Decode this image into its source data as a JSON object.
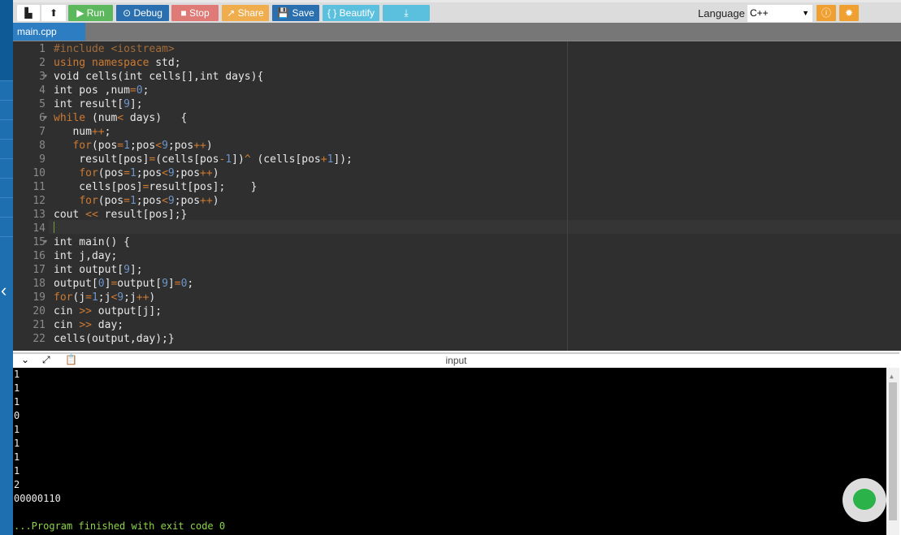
{
  "toolbar": {
    "run": "▶ Run",
    "debug": "⊙ Debug",
    "stop": "■ Stop",
    "share": "↗ Share",
    "save": "💾 Save",
    "beautify": "{ } Beautify",
    "language_label": "Language",
    "language_value": "C++"
  },
  "colors": {
    "run": "#5cb85c",
    "debug": "#2a6fb0",
    "stop": "#d9534f",
    "share": "#f0ad4e",
    "save": "#2a6fb0",
    "beautify": "#5bc0de",
    "accent": "#f0a030"
  },
  "file_tab": "main.cpp",
  "code": [
    [
      [
        "s",
        "#include <iostream>"
      ]
    ],
    [
      [
        "k",
        "using namespace"
      ],
      [
        "p",
        " std;"
      ]
    ],
    [
      [
        "p",
        "void cells(int cells[],int days){"
      ]
    ],
    [
      [
        "p",
        "int pos ,num"
      ],
      [
        "o",
        "="
      ],
      [
        "n",
        "0"
      ],
      [
        "p",
        ";"
      ]
    ],
    [
      [
        "p",
        "int result["
      ],
      [
        "n",
        "9"
      ],
      [
        "p",
        "];"
      ]
    ],
    [
      [
        "k",
        "while"
      ],
      [
        "p",
        " (num"
      ],
      [
        "o",
        "<"
      ],
      [
        "p",
        " days)   {"
      ]
    ],
    [
      [
        "p",
        "   num"
      ],
      [
        "o",
        "++"
      ],
      [
        "p",
        ";"
      ]
    ],
    [
      [
        "p",
        "   "
      ],
      [
        "k",
        "for"
      ],
      [
        "p",
        "(pos"
      ],
      [
        "o",
        "="
      ],
      [
        "n",
        "1"
      ],
      [
        "p",
        ";pos"
      ],
      [
        "o",
        "<"
      ],
      [
        "n",
        "9"
      ],
      [
        "p",
        ";pos"
      ],
      [
        "o",
        "++"
      ],
      [
        "p",
        ")"
      ]
    ],
    [
      [
        "p",
        "    result[pos]"
      ],
      [
        "o",
        "="
      ],
      [
        "p",
        "(cells[pos"
      ],
      [
        "o",
        "-"
      ],
      [
        "n",
        "1"
      ],
      [
        "p",
        "])"
      ],
      [
        "o",
        "^"
      ],
      [
        "p",
        " (cells[pos"
      ],
      [
        "o",
        "+"
      ],
      [
        "n",
        "1"
      ],
      [
        "p",
        "]);"
      ]
    ],
    [
      [
        "p",
        "    "
      ],
      [
        "k",
        "for"
      ],
      [
        "p",
        "(pos"
      ],
      [
        "o",
        "="
      ],
      [
        "n",
        "1"
      ],
      [
        "p",
        ";pos"
      ],
      [
        "o",
        "<"
      ],
      [
        "n",
        "9"
      ],
      [
        "p",
        ";pos"
      ],
      [
        "o",
        "++"
      ],
      [
        "p",
        ")"
      ]
    ],
    [
      [
        "p",
        "    cells[pos]"
      ],
      [
        "o",
        "="
      ],
      [
        "p",
        "result[pos];    }"
      ]
    ],
    [
      [
        "p",
        "    "
      ],
      [
        "k",
        "for"
      ],
      [
        "p",
        "(pos"
      ],
      [
        "o",
        "="
      ],
      [
        "n",
        "1"
      ],
      [
        "p",
        ";pos"
      ],
      [
        "o",
        "<"
      ],
      [
        "n",
        "9"
      ],
      [
        "p",
        ";pos"
      ],
      [
        "o",
        "++"
      ],
      [
        "p",
        ")"
      ]
    ],
    [
      [
        "p",
        "cout "
      ],
      [
        "o",
        "<<"
      ],
      [
        "p",
        " result[pos];}"
      ]
    ],
    [],
    [
      [
        "p",
        "int main() {"
      ]
    ],
    [
      [
        "p",
        "int j,day;"
      ]
    ],
    [
      [
        "p",
        "int output["
      ],
      [
        "n",
        "9"
      ],
      [
        "p",
        "];"
      ]
    ],
    [
      [
        "p",
        "output["
      ],
      [
        "n",
        "0"
      ],
      [
        "p",
        "]"
      ],
      [
        "o",
        "="
      ],
      [
        "p",
        "output["
      ],
      [
        "n",
        "9"
      ],
      [
        "p",
        "]"
      ],
      [
        "o",
        "="
      ],
      [
        "n",
        "0"
      ],
      [
        "p",
        ";"
      ]
    ],
    [
      [
        "k",
        "for"
      ],
      [
        "p",
        "(j"
      ],
      [
        "o",
        "="
      ],
      [
        "n",
        "1"
      ],
      [
        "p",
        ";j"
      ],
      [
        "o",
        "<"
      ],
      [
        "n",
        "9"
      ],
      [
        "p",
        ";j"
      ],
      [
        "o",
        "++"
      ],
      [
        "p",
        ")"
      ]
    ],
    [
      [
        "p",
        "cin "
      ],
      [
        "o",
        ">>"
      ],
      [
        "p",
        " output[j];"
      ]
    ],
    [
      [
        "p",
        "cin "
      ],
      [
        "o",
        ">>"
      ],
      [
        "p",
        " day;"
      ]
    ],
    [
      [
        "p",
        "cells(output,day);}"
      ]
    ]
  ],
  "fold_lines": [
    3,
    6,
    15
  ],
  "io_label": "input",
  "console": [
    "1",
    "1",
    "1",
    "0",
    "1",
    "1",
    "1",
    "1",
    "2",
    "00000110",
    "",
    "...Program finished with exit code 0"
  ]
}
